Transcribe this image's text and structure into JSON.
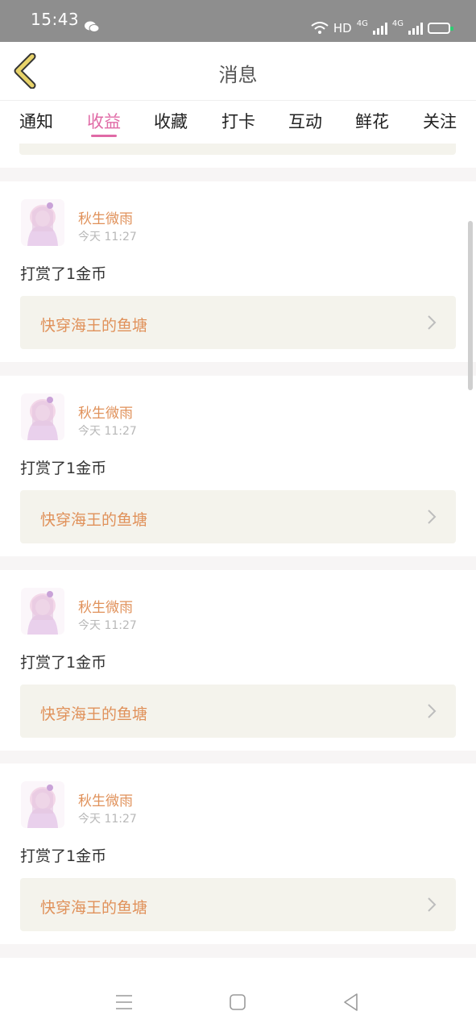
{
  "status_bar": {
    "time": "15:43",
    "network": "HD",
    "sim1": "4G",
    "sim2": "4G"
  },
  "header": {
    "title": "消息",
    "back_icon": "chevron-left-icon"
  },
  "tabs": [
    {
      "label": "通知",
      "active": false
    },
    {
      "label": "收益",
      "active": true
    },
    {
      "label": "收藏",
      "active": false
    },
    {
      "label": "打卡",
      "active": false
    },
    {
      "label": "互动",
      "active": false
    },
    {
      "label": "鲜花",
      "active": false
    },
    {
      "label": "关注",
      "active": false
    }
  ],
  "messages": [
    {
      "user": "秋生微雨",
      "time": "今天 11:27",
      "text": "打赏了1金币",
      "book": "快穿海王的鱼塘"
    },
    {
      "user": "秋生微雨",
      "time": "今天 11:27",
      "text": "打赏了1金币",
      "book": "快穿海王的鱼塘"
    },
    {
      "user": "秋生微雨",
      "time": "今天 11:27",
      "text": "打赏了1金币",
      "book": "快穿海王的鱼塘"
    },
    {
      "user": "秋生微雨",
      "time": "今天 11:27",
      "text": "打赏了1金币",
      "book": "快穿海王的鱼塘"
    }
  ],
  "colors": {
    "accent": "#e06aa6",
    "name": "#e0915a",
    "back": "#e8d36a"
  }
}
